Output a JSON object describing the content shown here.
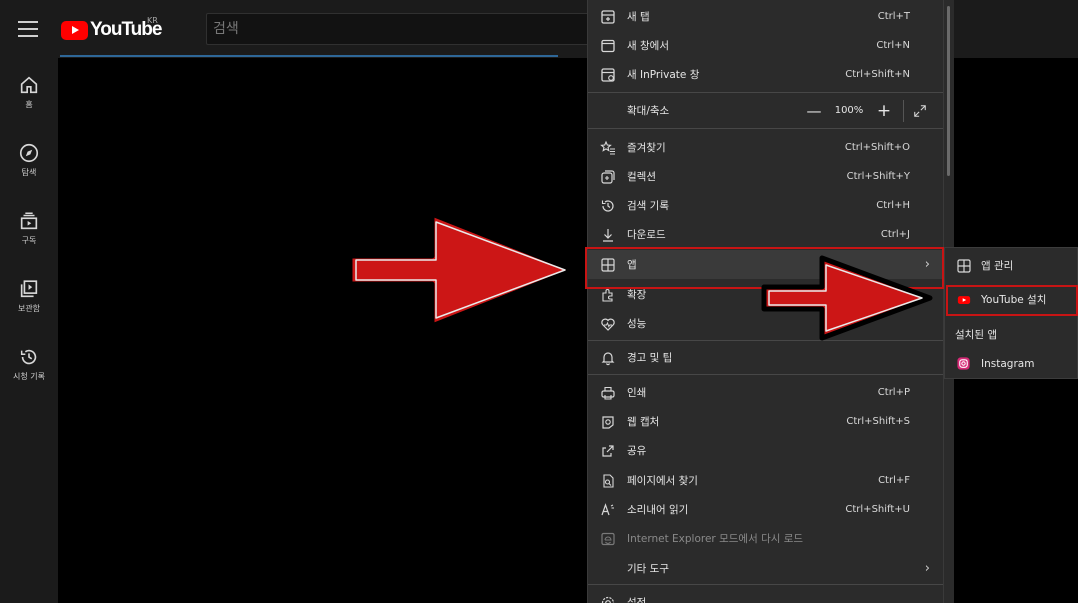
{
  "youtube": {
    "logo_text": "YouTube",
    "region": "KR",
    "search_placeholder": "검색",
    "sidebar": [
      {
        "label": "홈",
        "icon": "home-icon"
      },
      {
        "label": "탐색",
        "icon": "explore-compass-icon"
      },
      {
        "label": "구독",
        "icon": "subscriptions-icon"
      },
      {
        "label": "보관함",
        "icon": "library-icon"
      },
      {
        "label": "시청 기록",
        "icon": "history-icon"
      }
    ]
  },
  "edge_menu": {
    "items": [
      {
        "label": "새 탭",
        "shortcut": "Ctrl+T",
        "icon": "new-tab-icon"
      },
      {
        "label": "새 창에서",
        "shortcut": "Ctrl+N",
        "icon": "new-window-icon"
      },
      {
        "label": "새 InPrivate 창",
        "shortcut": "Ctrl+Shift+N",
        "icon": "inprivate-icon"
      },
      {
        "label": "즐겨찾기",
        "shortcut": "Ctrl+Shift+O",
        "icon": "favorites-icon"
      },
      {
        "label": "컬렉션",
        "shortcut": "Ctrl+Shift+Y",
        "icon": "collections-icon"
      },
      {
        "label": "검색 기록",
        "shortcut": "Ctrl+H",
        "icon": "history-icon"
      },
      {
        "label": "다운로드",
        "shortcut": "Ctrl+J",
        "icon": "download-icon"
      },
      {
        "label": "앱",
        "shortcut": "",
        "icon": "apps-icon"
      },
      {
        "label": "확장",
        "shortcut": "",
        "icon": "extensions-icon"
      },
      {
        "label": "성능",
        "shortcut": "",
        "icon": "performance-icon"
      },
      {
        "label": "경고 및 팁",
        "shortcut": "",
        "icon": "alerts-bell-icon"
      },
      {
        "label": "인쇄",
        "shortcut": "Ctrl+P",
        "icon": "print-icon"
      },
      {
        "label": "웹 캡처",
        "shortcut": "Ctrl+Shift+S",
        "icon": "web-capture-icon"
      },
      {
        "label": "공유",
        "shortcut": "",
        "icon": "share-icon"
      },
      {
        "label": "페이지에서 찾기",
        "shortcut": "Ctrl+F",
        "icon": "find-icon"
      },
      {
        "label": "소리내어 읽기",
        "shortcut": "Ctrl+Shift+U",
        "icon": "read-aloud-icon"
      },
      {
        "label": "Internet Explorer 모드에서 다시 로드",
        "shortcut": "",
        "icon": "ie-mode-icon"
      },
      {
        "label": "기타 도구",
        "shortcut": "",
        "icon": ""
      },
      {
        "label": "설정",
        "shortcut": "",
        "icon": "settings-icon"
      }
    ],
    "zoom": {
      "label": "확대/축소",
      "minus": "—",
      "value": "100%",
      "plus": "+"
    }
  },
  "apps_submenu": {
    "items": [
      {
        "label": "앱 관리",
        "icon": "apps-manage-icon"
      },
      {
        "label": "YouTube 설치",
        "icon": "youtube-icon"
      },
      {
        "label": "설치된 앱",
        "icon": ""
      },
      {
        "label": "Instagram",
        "icon": "instagram-icon"
      }
    ]
  },
  "colors": {
    "annotation_red": "#c81414",
    "youtube_red": "#ff0000",
    "menu_bg": "#2b2b2b"
  }
}
